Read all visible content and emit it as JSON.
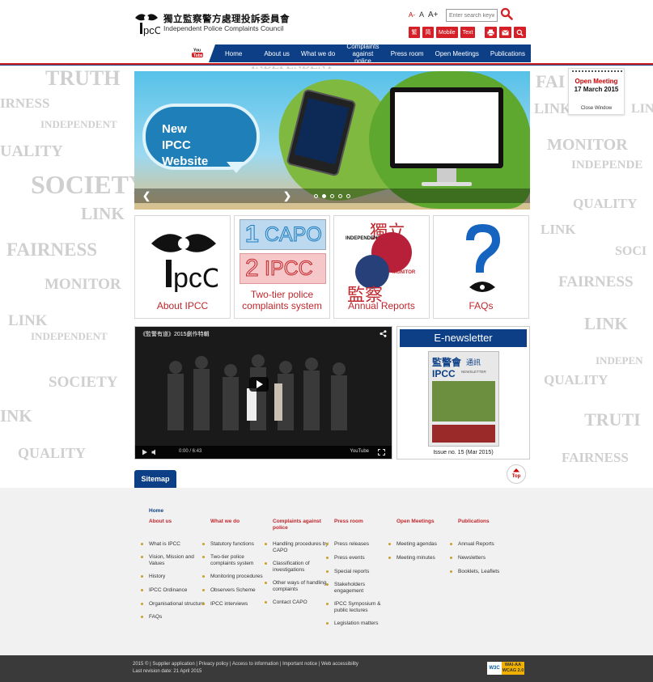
{
  "header": {
    "logo_text": "IPCC",
    "org_name_zh": "獨立監察警方處理投訴委員會",
    "org_name_en": "Independent Police Complaints Council",
    "font_size_small": "A-",
    "font_size_normal": "A",
    "font_size_large": "A+",
    "search_placeholder": "Enter search keyword(s)",
    "util": {
      "traditional": "繁",
      "simplified": "简",
      "mobile": "Mobile",
      "text": "Text",
      "print_icon": "print-icon",
      "email_icon": "email-icon",
      "zoom_icon": "zoom-icon"
    },
    "youtube_label": "You Tube"
  },
  "nav": {
    "items": [
      "Home",
      "About us",
      "What we do",
      "Complaints against police",
      "Press room",
      "Open Meetings",
      "Publications"
    ]
  },
  "background_words": [
    "TRUTH",
    "IRNESS",
    "INDEPENDENT",
    "UALITY",
    "SOCIETY",
    "LINK",
    "FAIRNESS",
    "MONITOR",
    "LINK",
    "INDEPENDENT",
    "SOCIETY",
    "INK",
    "QUALITY",
    "FAI",
    "MONITOR",
    "INDEPENDE",
    "QUALITY",
    "LINK",
    "SOCI",
    "FAIRNESS",
    "LINK",
    "INDEPEN",
    "QUALITY",
    "TRUTI",
    "FAIRNESS",
    "INDEPENDENT",
    "LINK",
    "LINK"
  ],
  "banner": {
    "headline_line1": "New",
    "headline_line2": "IPCC Website",
    "dots": [
      false,
      true,
      false,
      false,
      false
    ]
  },
  "tiles": [
    {
      "label": "About IPCC"
    },
    {
      "label": "Two-tier police complaints system",
      "num1": "1",
      "word1": "CAPO",
      "num2": "2",
      "word2": "IPCC"
    },
    {
      "label": "Annual Reports",
      "zh1": "獨立",
      "zh2": "監察",
      "en1": "INDEPENDENT",
      "en2": "MONITOR"
    },
    {
      "label": "FAQs"
    }
  ],
  "video": {
    "title": "《監警有道》2015劇作特輯",
    "time": "0:00 / 6:43",
    "logo": "YouTube"
  },
  "enewsletter": {
    "title": "E-newsletter",
    "cover_title_zh": "監警會",
    "cover_subtitle_zh": "通訊",
    "cover_newsletter": "NEWSLETTER",
    "issue": "Issue no. 15 (Mar 2015)"
  },
  "meeting": {
    "title": "Open Meeting",
    "date": "17 March 2015",
    "close": "Close Window"
  },
  "sitemap": {
    "tab": "Sitemap",
    "top": "Top",
    "home": "Home",
    "columns": [
      {
        "head": "About us",
        "items": [
          "What is IPCC",
          "Vision, Mission and Values",
          "History",
          "IPCC Ordinance",
          "Organisational structure",
          "FAQs"
        ]
      },
      {
        "head": "What we do",
        "items": [
          "Statutory functions",
          "Two-tier police complaints system",
          "Monitoring procedures",
          "Observers Scheme",
          "IPCC interviews"
        ]
      },
      {
        "head": "Complaints against police",
        "items": [
          "Handling procedures by CAPO",
          "Classification of investigations",
          "Other ways of handling complaints",
          "Contact CAPO"
        ]
      },
      {
        "head": "Press room",
        "items": [
          "Press releases",
          "Press events",
          "Special reports",
          "Stakeholders engagement",
          "IPCC Symposium & public lectures",
          "Legislation matters"
        ]
      },
      {
        "head": "Open Meetings",
        "items": [
          "Meeting agendas",
          "Meeting minutes"
        ]
      },
      {
        "head": "Publications",
        "items": [
          "Annual Reports",
          "Newsletters",
          "Booklets, Leaflets"
        ]
      }
    ]
  },
  "footer": {
    "links": "2015 © | Supplier application | Privacy policy | Access to information | Important notice | Web accessibility",
    "revision": "Last revision date: 21 April 2015",
    "w3c": "W3C",
    "wai": "WAI-AA",
    "wcag": "WCAG 2.0"
  },
  "colors": {
    "nav": "#0c3f86",
    "accent_red": "#c1272d",
    "footer": "#3a3a3a"
  }
}
